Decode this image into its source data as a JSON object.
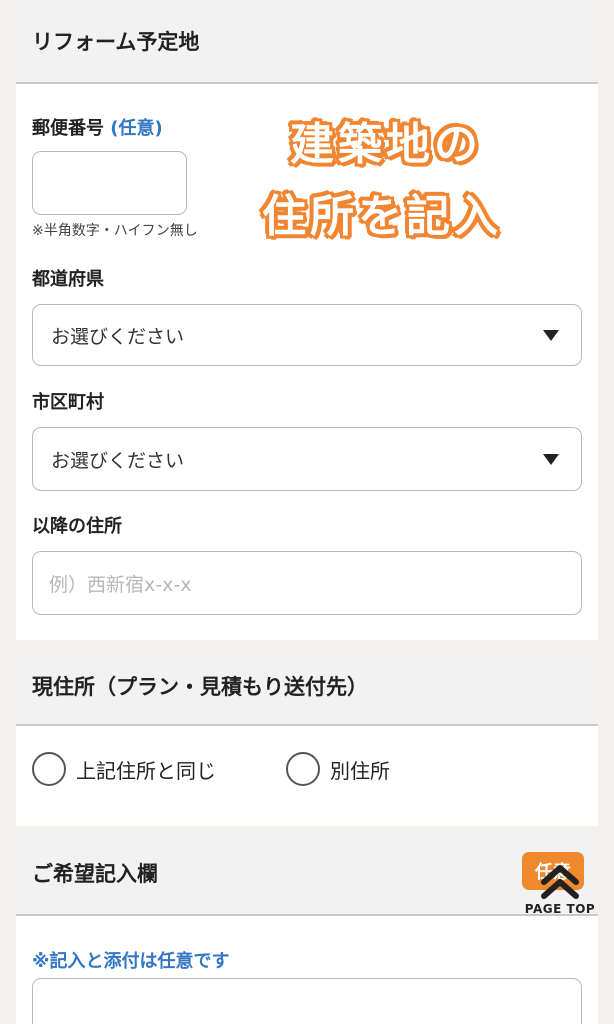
{
  "reform_section": {
    "title": "リフォーム予定地",
    "postal": {
      "label": "郵便番号",
      "optional_tag": "(任意)",
      "value": "",
      "note": "※半角数字・ハイフン無し"
    },
    "prefecture": {
      "label": "都道府県",
      "selected": "お選びください"
    },
    "city": {
      "label": "市区町村",
      "selected": "お選びください"
    },
    "address": {
      "label": "以降の住所",
      "placeholder": "例）西新宿x-x-x"
    }
  },
  "overlay": {
    "line1": "建築地の",
    "line2": "住所を記入"
  },
  "current_section": {
    "title": "現住所（プラン・見積もり送付先）",
    "options": [
      "上記住所と同じ",
      "別住所"
    ]
  },
  "request_section": {
    "title": "ご希望記入欄",
    "badge": "任意",
    "note": "※記入と添付は任意です"
  },
  "page_top": {
    "label": "PAGE TOP",
    "icon": "double-chevron-up-icon"
  },
  "colors": {
    "accent_orange": "#ee8a2d",
    "link_blue": "#3377c4"
  }
}
